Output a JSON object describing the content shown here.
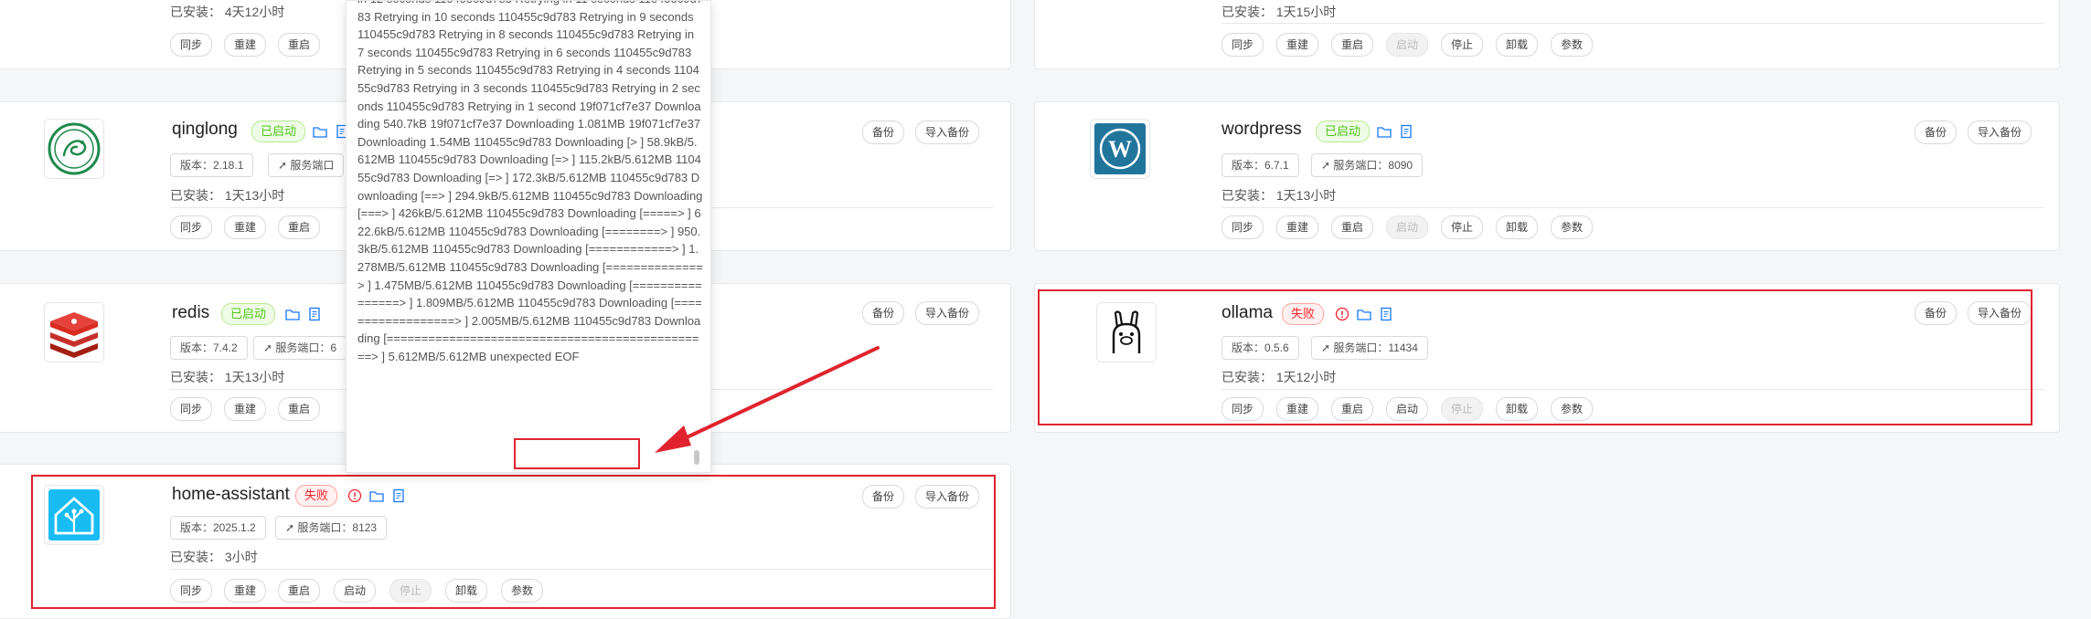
{
  "labels": {
    "version_prefix": "版本：",
    "installed_prefix": "已安装：",
    "port_prefix": "服务端口：",
    "backup": "备份",
    "import_backup": "导入备份",
    "sync": "同步",
    "rebuild": "重建",
    "restart": "重启",
    "start": "启动",
    "stop": "停止",
    "uninstall": "卸载",
    "params": "参数"
  },
  "top_left": {
    "installed": "已安装：  4天12小时"
  },
  "top_right": {
    "installed": "已安装：  1天15小时"
  },
  "apps": {
    "qinglong": {
      "name": "qinglong",
      "status": "已启动",
      "version": "版本：2.18.1",
      "port": "服务端口",
      "installed": "已安装：  1天13小时"
    },
    "wordpress": {
      "name": "wordpress",
      "status": "已启动",
      "version": "版本：6.7.1",
      "port": "服务端口：8090",
      "installed": "已安装：  1天13小时"
    },
    "redis": {
      "name": "redis",
      "status": "已启动",
      "version": "版本：7.4.2",
      "port": "服务端口：6",
      "installed": "已安装：  1天13小时"
    },
    "ollama": {
      "name": "ollama",
      "status": "失败",
      "version": "版本：0.5.6",
      "port": "服务端口：11434",
      "installed": "已安装：  1天12小时"
    },
    "home_assistant": {
      "name": "home-assistant",
      "status": "失败",
      "version": "版本：2025.1.2",
      "port": "服务端口：8123",
      "installed": "已安装：  3小时"
    }
  },
  "log": {
    "text": "in 12 seconds 110455c9d783 Retrying in 11 seconds 110455c9d783 Retrying in 10 seconds 110455c9d783 Retrying in 9 seconds 110455c9d783 Retrying in 8 seconds 110455c9d783 Retrying in 7 seconds 110455c9d783 Retrying in 6 seconds 110455c9d783 Retrying in 5 seconds 110455c9d783 Retrying in 4 seconds 110455c9d783 Retrying in 3 seconds 110455c9d783 Retrying in 2 seconds 110455c9d783 Retrying in 1 second 19f071cf7e37 Downloading 540.7kB 19f071cf7e37 Downloading 1.081MB 19f071cf7e37 Downloading 1.54MB 110455c9d783 Downloading [> ] 58.9kB/5.612MB 110455c9d783 Downloading [=> ] 115.2kB/5.612MB 110455c9d783 Downloading [=> ] 172.3kB/5.612MB 110455c9d783 Downloading [==> ] 294.9kB/5.612MB 110455c9d783 Downloading [===> ] 426kB/5.612MB 110455c9d783 Downloading [=====> ] 622.6kB/5.612MB 110455c9d783 Downloading [========> ] 950.3kB/5.612MB 110455c9d783 Downloading [============> ] 1.278MB/5.612MB 110455c9d783 Downloading [==============> ] 1.475MB/5.612MB 110455c9d783 Downloading [================> ] 1.809MB/5.612MB 110455c9d783 Downloading [==================> ] 2.005MB/5.612MB 110455c9d783 Downloading [===============================================> ] 5.612MB/5.612MB unexpected EOF"
  },
  "colors": {
    "highlight_red": "#e0232e",
    "status_ok": "#52c41a",
    "status_fail": "#f5222d"
  }
}
